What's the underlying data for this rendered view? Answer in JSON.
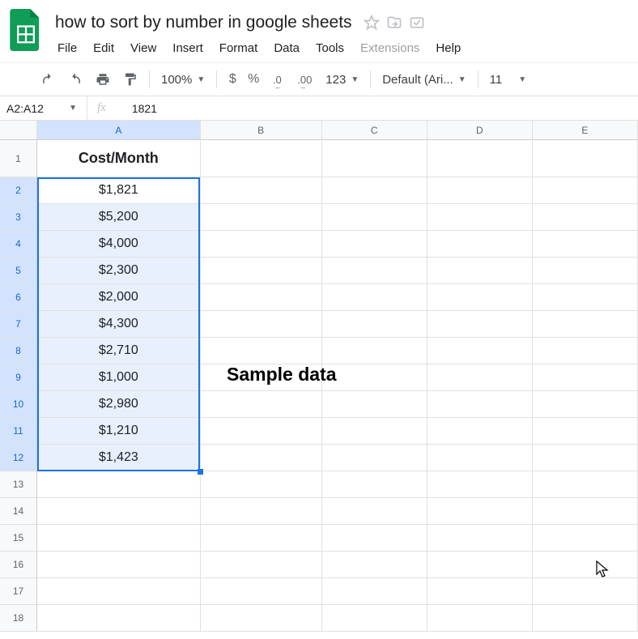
{
  "doc": {
    "title": "how to sort by number in google sheets"
  },
  "menu": {
    "file": "File",
    "edit": "Edit",
    "view": "View",
    "insert": "Insert",
    "format": "Format",
    "data": "Data",
    "tools": "Tools",
    "extensions": "Extensions",
    "help": "Help"
  },
  "toolbar": {
    "zoom": "100%",
    "dollar": "$",
    "percent": "%",
    "dec_decrease": ".0",
    "dec_increase": ".00",
    "numfmt": "123",
    "font": "Default (Ari...",
    "fontsize": "11"
  },
  "namebox": {
    "range": "A2:A12"
  },
  "formula": {
    "value": "1821"
  },
  "columns": [
    "A",
    "B",
    "C",
    "D",
    "E"
  ],
  "header_cell": "Cost/Month",
  "sample_label": "Sample data",
  "data_rows": [
    "$1,821",
    "$5,200",
    "$4,000",
    "$2,300",
    "$2,000",
    "$4,300",
    "$2,710",
    "$1,000",
    "$2,980",
    "$1,210",
    "$1,423"
  ],
  "row_numbers": [
    1,
    2,
    3,
    4,
    5,
    6,
    7,
    8,
    9,
    10,
    11,
    12,
    13,
    14,
    15,
    16,
    17,
    18
  ]
}
